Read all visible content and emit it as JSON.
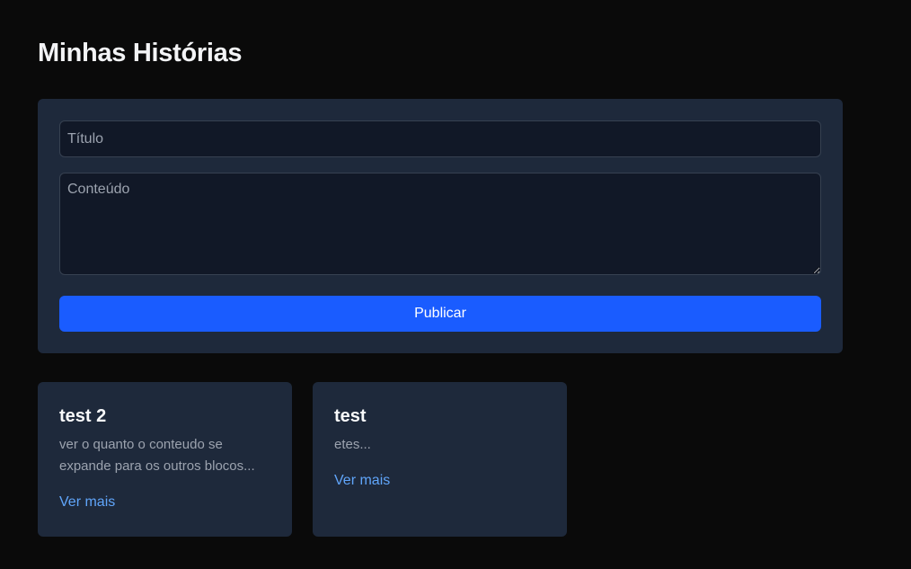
{
  "page": {
    "title": "Minhas Histórias"
  },
  "form": {
    "title_placeholder": "Título",
    "content_placeholder": "Conteúdo",
    "publish_label": "Publicar"
  },
  "stories": [
    {
      "title": "test 2",
      "excerpt": "ver o quanto o conteudo se expande para os outros blocos...",
      "link_label": "Ver mais"
    },
    {
      "title": "test",
      "excerpt": "etes...",
      "link_label": "Ver mais"
    }
  ],
  "colors": {
    "background": "#0a0a0a",
    "card": "#1e293b",
    "input": "#111827",
    "accent": "#1a5cff",
    "link": "#60a5fa"
  }
}
